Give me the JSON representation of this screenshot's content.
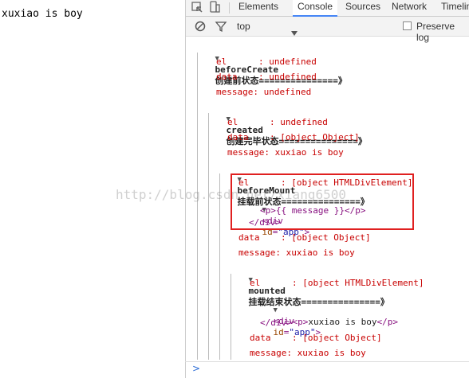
{
  "page": {
    "text": "xuxiao is boy"
  },
  "devtools": {
    "tabs": [
      "Elements",
      "Console",
      "Sources",
      "Network",
      "Timelin"
    ],
    "active_tab": "Console",
    "filter": {
      "context": "top",
      "preserve_log": "Preserve log"
    },
    "accent_color": "#4585f6"
  },
  "console": {
    "beforeCreate": {
      "header_name": "beforeCreate",
      "header_status": "创建前状态===============》",
      "el": "el      : undefined",
      "data": "data    : undefined",
      "message": "message: undefined"
    },
    "created": {
      "header_name": "created",
      "header_status": "创建完毕状态===============》",
      "el": "el      : undefined",
      "data": "data    : [object Object]",
      "message": "message: xuxiao is boy"
    },
    "beforeMount": {
      "header_name": "beforeMount",
      "header_status": "挂载前状态===============》",
      "el": "el      : [object HTMLDivElement]",
      "div_open_tag": "<div",
      "div_attr_name": "id",
      "div_attr_value": "\"app\"",
      "inner": "<p>{{ message }}</p>",
      "div_close": "</div>",
      "data": "data    : [object Object]",
      "message": "message: xuxiao is boy"
    },
    "mounted": {
      "header_name": "mounted",
      "header_status": "挂载结束状态===============》",
      "el": "el      : [object HTMLDivElement]",
      "div_open_tag": "<div",
      "div_attr_name": "id",
      "div_attr_value": "\"app\"",
      "inner_open": "<p>",
      "inner_text": "xuxiao is boy",
      "inner_close": "</p>",
      "div_close": "</div>",
      "data": "data    : [object Object]",
      "message": "message: xuxiao is boy"
    },
    "prompt": ">"
  },
  "watermark": "http://blog.csdn.net/xiang6500"
}
